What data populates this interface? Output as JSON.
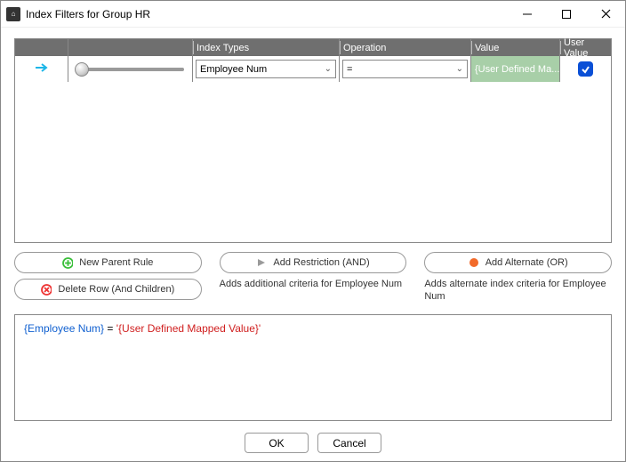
{
  "window": {
    "title": "Index Filters for Group HR"
  },
  "grid": {
    "headers": {
      "index_types": "Index Types",
      "operation": "Operation",
      "value": "Value",
      "user_value": "User Value"
    },
    "row": {
      "index_type": "Employee Num",
      "operation": "=",
      "value": "{User Defined Ma...",
      "user_value_checked": "✓"
    }
  },
  "buttons": {
    "new_parent": "New Parent Rule",
    "delete_row": "Delete Row (And Children)",
    "add_restriction": "Add Restriction (AND)",
    "restriction_hint": "Adds additional criteria for Employee Num",
    "add_alternate": "Add Alternate (OR)",
    "alternate_hint": "Adds alternate index criteria for Employee Num"
  },
  "expression": {
    "field": "{Employee Num}",
    "operator": " = ",
    "value": "'{User Defined Mapped Value}'"
  },
  "footer": {
    "ok": "OK",
    "cancel": "Cancel"
  }
}
